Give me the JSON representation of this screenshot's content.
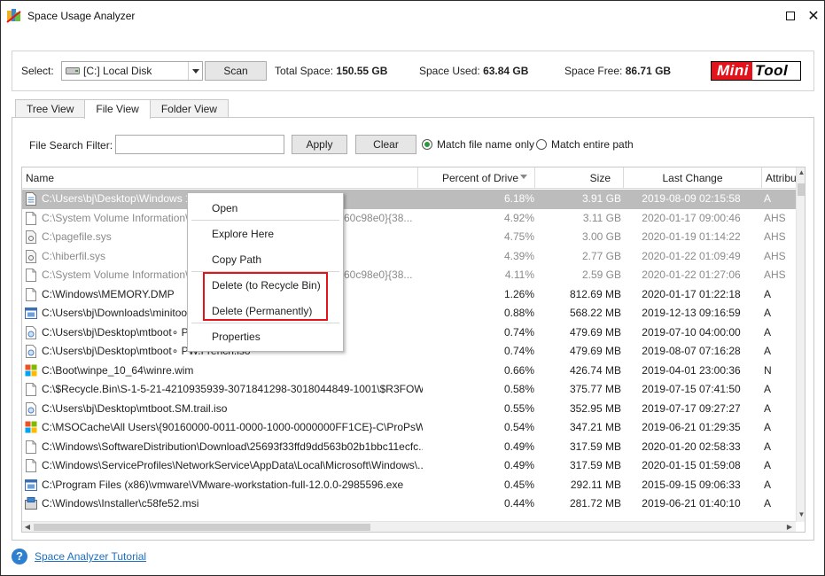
{
  "window": {
    "title": "Space Usage Analyzer"
  },
  "toolbar": {
    "select_label": "Select:",
    "drive": "[C:] Local Disk",
    "scan_label": "Scan",
    "total_label": "Total Space:",
    "total_value": "150.55 GB",
    "used_label": "Space Used:",
    "used_value": "63.84 GB",
    "free_label": "Space Free:",
    "free_value": "86.71 GB",
    "logo_mini": "Mini",
    "logo_tool": "Tool"
  },
  "tabs": [
    {
      "label": "Tree View",
      "active": false
    },
    {
      "label": "File View",
      "active": true
    },
    {
      "label": "Folder View",
      "active": false
    }
  ],
  "filter": {
    "label": "File Search Filter:",
    "value": "",
    "apply_label": "Apply",
    "clear_label": "Clear",
    "radio_name_only": "Match file name only",
    "radio_entire_path": "Match entire path",
    "selected": "name_only"
  },
  "columns": {
    "name": "Name",
    "percent": "Percent of Drive",
    "size": "Size",
    "last_change": "Last Change",
    "attributes": "Attribu"
  },
  "rows": [
    {
      "icon": "text-file-icon",
      "name": "C:\\Users\\bj\\Desktop\\Windows 1",
      "percent": "6.18%",
      "size": "3.91 GB",
      "date": "2019-08-09 02:15:58",
      "attr": "A",
      "selected": true,
      "gray": false
    },
    {
      "icon": "file-icon",
      "name": "C:\\System Volume Information\\{",
      "name_tail": "60c98e0}{38...",
      "percent": "4.92%",
      "size": "3.11 GB",
      "date": "2020-01-17 09:00:46",
      "attr": "AHS",
      "selected": false,
      "gray": true
    },
    {
      "icon": "system-file-icon",
      "name": "C:\\pagefile.sys",
      "percent": "4.75%",
      "size": "3.00 GB",
      "date": "2020-01-19 01:14:22",
      "attr": "AHS",
      "selected": false,
      "gray": true
    },
    {
      "icon": "system-file-icon",
      "name": "C:\\hiberfil.sys",
      "percent": "4.39%",
      "size": "2.77 GB",
      "date": "2020-01-22 01:09:49",
      "attr": "AHS",
      "selected": false,
      "gray": true
    },
    {
      "icon": "file-icon",
      "name": "C:\\System Volume Information\\{",
      "name_tail": "60c98e0}{38...",
      "percent": "4.11%",
      "size": "2.59 GB",
      "date": "2020-01-22 01:27:06",
      "attr": "AHS",
      "selected": false,
      "gray": true
    },
    {
      "icon": "file-icon",
      "name": "C:\\Windows\\MEMORY.DMP",
      "percent": "1.26%",
      "size": "812.69 MB",
      "date": "2020-01-17 01:22:18",
      "attr": "A",
      "selected": false,
      "gray": false
    },
    {
      "icon": "installer-icon",
      "name": "C:\\Users\\bj\\Downloads\\minitool",
      "percent": "0.88%",
      "size": "568.22 MB",
      "date": "2019-12-13 09:16:59",
      "attr": "A",
      "selected": false,
      "gray": false
    },
    {
      "icon": "disc-image-icon",
      "name": "C:\\Users\\bj\\Desktop\\mtboot∘ PW",
      "percent": "0.74%",
      "size": "479.69 MB",
      "date": "2019-07-10 04:00:00",
      "attr": "A",
      "selected": false,
      "gray": false
    },
    {
      "icon": "disc-image-icon",
      "name": "C:\\Users\\bj\\Desktop\\mtboot∘ PW.French.iso",
      "percent": "0.74%",
      "size": "479.69 MB",
      "date": "2019-08-07 07:16:28",
      "attr": "A",
      "selected": false,
      "gray": false
    },
    {
      "icon": "wim-icon",
      "name": "C:\\Boot\\winpe_10_64\\winre.wim",
      "percent": "0.66%",
      "size": "426.74 MB",
      "date": "2019-04-01 23:00:36",
      "attr": "N",
      "selected": false,
      "gray": false
    },
    {
      "icon": "file-icon",
      "name": "C:\\$Recycle.Bin\\S-1-5-21-4210935939-3071841298-3018044849-1001\\$R3FOW...",
      "percent": "0.58%",
      "size": "375.77 MB",
      "date": "2019-07-15 07:41:50",
      "attr": "A",
      "selected": false,
      "gray": false
    },
    {
      "icon": "disc-image-icon",
      "name": "C:\\Users\\bj\\Desktop\\mtboot.SM.trail.iso",
      "percent": "0.55%",
      "size": "352.95 MB",
      "date": "2019-07-17 09:27:27",
      "attr": "A",
      "selected": false,
      "gray": false
    },
    {
      "icon": "cab-icon",
      "name": "C:\\MSOCache\\All Users\\{90160000-0011-0000-1000-0000000FF1CE}-C\\ProPsW...",
      "percent": "0.54%",
      "size": "347.21 MB",
      "date": "2019-06-21 01:29:35",
      "attr": "A",
      "selected": false,
      "gray": false
    },
    {
      "icon": "file-icon",
      "name": "C:\\Windows\\SoftwareDistribution\\Download\\25693f33ffd9dd563b02b1bbc11ecfc...",
      "percent": "0.49%",
      "size": "317.59 MB",
      "date": "2020-01-20 02:58:33",
      "attr": "A",
      "selected": false,
      "gray": false
    },
    {
      "icon": "file-icon",
      "name": "C:\\Windows\\ServiceProfiles\\NetworkService\\AppData\\Local\\Microsoft\\Windows\\...",
      "percent": "0.49%",
      "size": "317.59 MB",
      "date": "2020-01-15 01:59:08",
      "attr": "A",
      "selected": false,
      "gray": false
    },
    {
      "icon": "installer-icon",
      "name": "C:\\Program Files (x86)\\vmware\\VMware-workstation-full-12.0.0-2985596.exe",
      "percent": "0.45%",
      "size": "292.11 MB",
      "date": "2015-09-15 09:06:33",
      "attr": "A",
      "selected": false,
      "gray": false
    },
    {
      "icon": "msi-icon",
      "name": "C:\\Windows\\Installer\\c58fe52.msi",
      "percent": "0.44%",
      "size": "281.72 MB",
      "date": "2019-06-21 01:40:10",
      "attr": "A",
      "selected": false,
      "gray": false
    }
  ],
  "context_menu": {
    "open": "Open",
    "explore": "Explore Here",
    "copy_path": "Copy Path",
    "delete_recycle": "Delete (to Recycle Bin)",
    "delete_permanent": "Delete (Permanently)",
    "properties": "Properties"
  },
  "footer": {
    "tutorial_link": "Space Analyzer Tutorial"
  },
  "colors": {
    "brand_red": "#e4131b",
    "selected_row": "#bcbcbc",
    "link_blue": "#1f6fbf",
    "radio_green": "#2a9a3c"
  }
}
